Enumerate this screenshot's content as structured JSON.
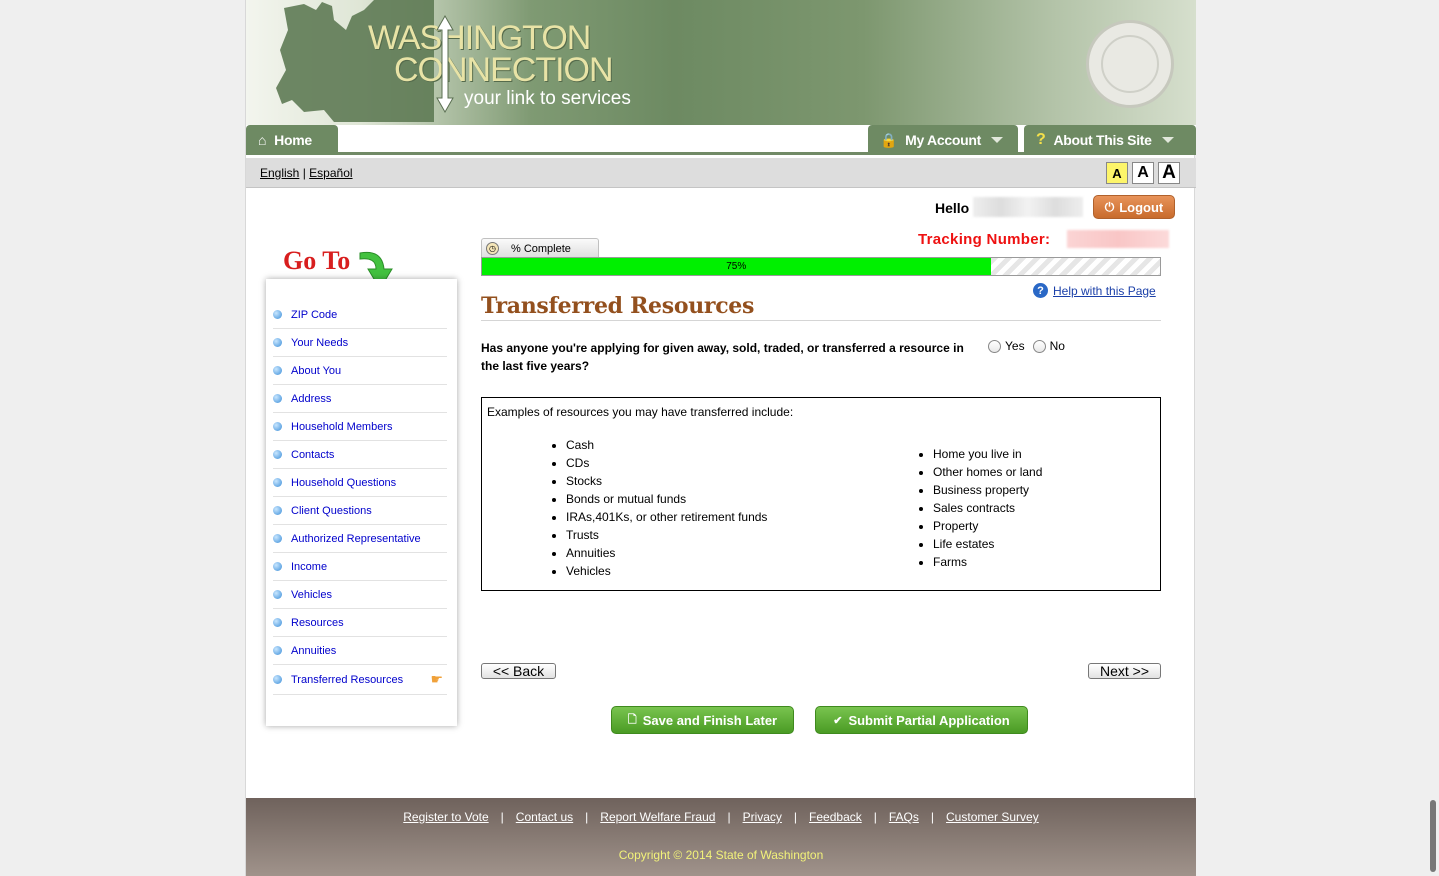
{
  "logo": {
    "line1": "WASHINGTON",
    "line2": "CONNECTION",
    "tagline": "your link to services"
  },
  "seal": {
    "text": "THE SEAL OF THE STATE OF WASHINGTON 1889"
  },
  "nav": {
    "home": "Home",
    "my_account": "My Account",
    "about": "About This Site"
  },
  "lang": {
    "english": "English",
    "separator": "|",
    "spanish": "Español"
  },
  "font_sizes": [
    "A",
    "A",
    "A"
  ],
  "user": {
    "hello": "Hello",
    "logout": "Logout",
    "tracking_label": "Tracking Number:"
  },
  "goto": {
    "title": "Go To"
  },
  "sidebar": {
    "items": [
      {
        "label": "ZIP Code"
      },
      {
        "label": "Your Needs"
      },
      {
        "label": "About You"
      },
      {
        "label": "Address"
      },
      {
        "label": "Household Members"
      },
      {
        "label": "Contacts"
      },
      {
        "label": "Household Questions"
      },
      {
        "label": "Client Questions"
      },
      {
        "label": "Authorized Representative"
      },
      {
        "label": "Income"
      },
      {
        "label": "Vehicles"
      },
      {
        "label": "Resources"
      },
      {
        "label": "Annuities"
      },
      {
        "label": "Transferred Resources"
      }
    ]
  },
  "progress": {
    "tab_label": "% Complete",
    "value_text": "75%",
    "fraction": 0.75
  },
  "help": {
    "label": "Help with this Page"
  },
  "main": {
    "title": "Transferred Resources",
    "question": "Has anyone you're applying for given away, sold, traded, or transferred a resource in the last five years?",
    "yes": "Yes",
    "no": "No",
    "examples_intro": "Examples of resources you may have transferred include:",
    "col1": [
      "Cash",
      "CDs",
      "Stocks",
      "Bonds or mutual funds",
      "IRAs,401Ks, or other retirement funds",
      "Trusts",
      "Annuities",
      "Vehicles"
    ],
    "col2": [
      "Home you live in",
      "Other homes or land",
      "Business property",
      "Sales contracts",
      "Property",
      "Life estates",
      "Farms"
    ],
    "back": "<< Back",
    "next": "Next >>",
    "save": "Save and Finish Later",
    "submit": "Submit Partial Application"
  },
  "footer": {
    "links": [
      "Register to Vote",
      "Contact us",
      "Report Welfare Fraud",
      "Privacy",
      "Feedback",
      "FAQs",
      "Customer Survey"
    ],
    "copyright": "Copyright © 2014 State of Washington"
  },
  "colors": {
    "accent_green": "#6e8a63",
    "title_brown": "#93501e",
    "progress_green": "#00f000",
    "tracking_red": "#e11111"
  }
}
